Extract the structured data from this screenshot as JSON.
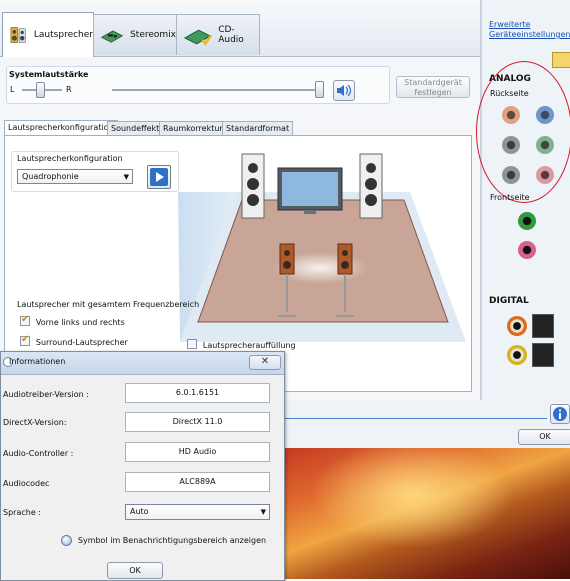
{
  "tabs": {
    "speakers": "Lautsprecher",
    "stereomix": "Stereomix",
    "cdaudio": "CD-Audio"
  },
  "volume": {
    "title": "Systemlautstärke",
    "left": "L",
    "right": "R",
    "default_button": "Standardgerät festlegen"
  },
  "subtabs": [
    "Lautsprecherkonfiguration",
    "Soundeffekt",
    "Raumkorrektur",
    "Standardformat"
  ],
  "config": {
    "group_label": "Lautsprecherkonfiguration",
    "selected": "Quadrophonie",
    "fullrange_label": "Lautsprecher mit gesamtem Frequenzbereich",
    "front_lr": "Vorne links und rechts",
    "surround": "Surround-Lautsprecher",
    "speaker_fill": "Lautsprecherauffüllung"
  },
  "sidebar": {
    "advanced_link": "Erweiterte Geräteeinstellungen",
    "analog_heading": "ANALOG",
    "back_label": "Rückseite",
    "front_label": "Frontseite",
    "digital_heading": "DIGITAL",
    "jack_colors": {
      "orange": "#e0a081",
      "blue": "#6f95c9",
      "grey": "#8f9499",
      "green": "#7fb28c",
      "pink": "#d99aa2",
      "front_green": "#2e9a3e",
      "front_pink": "#d8638a"
    }
  },
  "main_ok": "OK",
  "info": {
    "title": "Informationen",
    "rows": [
      {
        "label": "Audiotreiber-Version :",
        "value": "6.0.1.6151"
      },
      {
        "label": "DirectX-Version:",
        "value": "DirectX 11.0"
      },
      {
        "label": "Audio-Controller :",
        "value": "HD Audio"
      },
      {
        "label": "Audiocodec",
        "value": "ALC889A"
      }
    ],
    "language_label": "Sprache :",
    "language_value": "Auto",
    "tray_option": "Symbol im Benachrichtigungsbereich anzeigen",
    "ok": "OK"
  }
}
